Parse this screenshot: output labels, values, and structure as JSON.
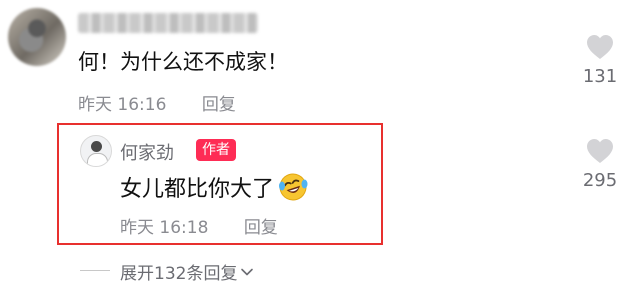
{
  "comment": {
    "text": "何！为什么还不成家！",
    "time": "昨天 16:16",
    "reply_label": "回复",
    "likes": "131"
  },
  "author_reply": {
    "name": "何家劲",
    "badge": "作者",
    "text": "女儿都比你大了",
    "emoji_icon": "laughing-tears-emoji-icon",
    "time": "昨天 16:18",
    "reply_label": "回复",
    "likes": "295"
  },
  "expand": {
    "label": "展开132条回复"
  },
  "colors": {
    "highlight_border": "#e8302e",
    "author_badge": "#fe2c55",
    "meta_text": "#8a8b91"
  }
}
